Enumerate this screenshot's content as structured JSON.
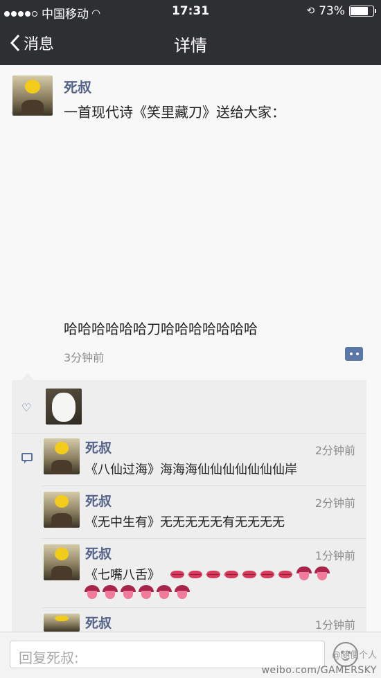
{
  "status": {
    "carrier": "中国移动",
    "time": "17:31",
    "battery": "73%",
    "battery_level": 0.73
  },
  "nav": {
    "back_label": "消息",
    "title": "详情"
  },
  "post": {
    "author": "死叔",
    "text1": "一首现代诗《笑里藏刀》送给大家：",
    "text2": "哈哈哈哈哈哈刀哈哈哈哈哈哈哈",
    "time": "3分钟前"
  },
  "comments": [
    {
      "name": "死叔",
      "time": "2分钟前",
      "text": "《八仙过海》海海海仙仙仙仙仙仙仙岸"
    },
    {
      "name": "死叔",
      "time": "2分钟前",
      "text": "《无中生有》无无无无无有无无无无"
    },
    {
      "name": "死叔",
      "time": "1分钟前",
      "text": "《七嘴八舌》"
    },
    {
      "name": "死叔",
      "time": "1分钟前",
      "text": ""
    }
  ],
  "reply": {
    "placeholder": "回复死叔:"
  },
  "watermark": {
    "site": "weibo.com/GAMERSKY",
    "tag": "@随便个人"
  },
  "colors": {
    "nav_bg": "#2d2f33",
    "name_blue": "#55638b",
    "accent": "#5a77a8"
  }
}
